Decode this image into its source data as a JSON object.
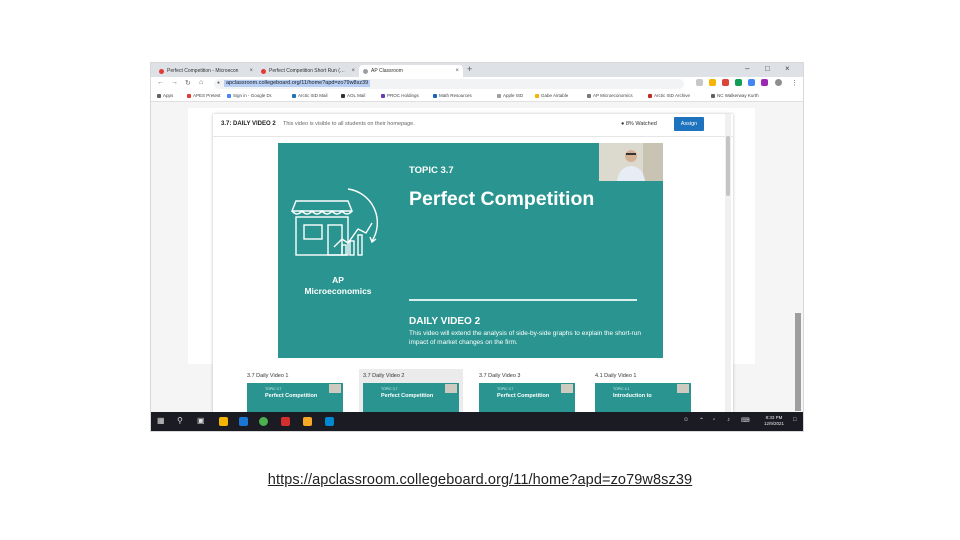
{
  "browser": {
    "tabs": [
      {
        "label": "Perfect Competition - Microecon",
        "close": "×"
      },
      {
        "label": "Perfect Competition Short Run (…",
        "close": "×"
      },
      {
        "label": "AP Classroom",
        "close": "×"
      }
    ],
    "new_tab": "+",
    "window_controls": {
      "minimize": "–",
      "maximize": "□",
      "close": "×"
    },
    "url": "apclassroom.collegeboard.org/11/home?apd=zo79w8sz39",
    "bookmarks": [
      "Apps",
      "APES Pretest",
      "Sign in - Google Dr.",
      "Arctic ISD Mail",
      "AOL Mail",
      "PROC Holdings",
      "Math Resources",
      "Apple ISD",
      "Gabe Airtable",
      "AP Microeconomics",
      "Arctic ISD Archive",
      "NC Walkerway Kurth"
    ]
  },
  "modal": {
    "title": "3.7: DAILY VIDEO 2",
    "subtitle": "This video is visible to all students on their homepage.",
    "watchers": "8% Watched",
    "assign_label": "Assign"
  },
  "video": {
    "topic": "TOPIC 3.7",
    "title": "Perfect Competition",
    "course_line1": "AP",
    "course_line2": "Microeconomics",
    "daily": "DAILY VIDEO 2",
    "description": "This video will extend the analysis of side-by-side graphs to explain the short-run impact of market changes on the firm."
  },
  "playlist": [
    {
      "label": "3.7 Daily Video 1",
      "mini_topic": "TOPIC 3.7",
      "mini_title": "Perfect Competition"
    },
    {
      "label": "3.7 Daily Video 2",
      "mini_topic": "TOPIC 3.7",
      "mini_title": "Perfect Competition"
    },
    {
      "label": "3.7 Daily Video 3",
      "mini_topic": "TOPIC 3.7",
      "mini_title": "Perfect Competition"
    },
    {
      "label": "4.1 Daily Video 1",
      "mini_topic": "TOPIC 4.1",
      "mini_title": "Introduction to"
    }
  ],
  "taskbar": {
    "clock_time": "8:33 PM",
    "clock_date": "12/9/2021"
  },
  "caption": {
    "link_text": "https://apclassroom.collegeboard.org/11/home?apd=zo79w8sz39"
  },
  "colors": {
    "teal": "#2a9590",
    "assign_blue": "#1e73be",
    "taskbar": "#1b1b24"
  }
}
